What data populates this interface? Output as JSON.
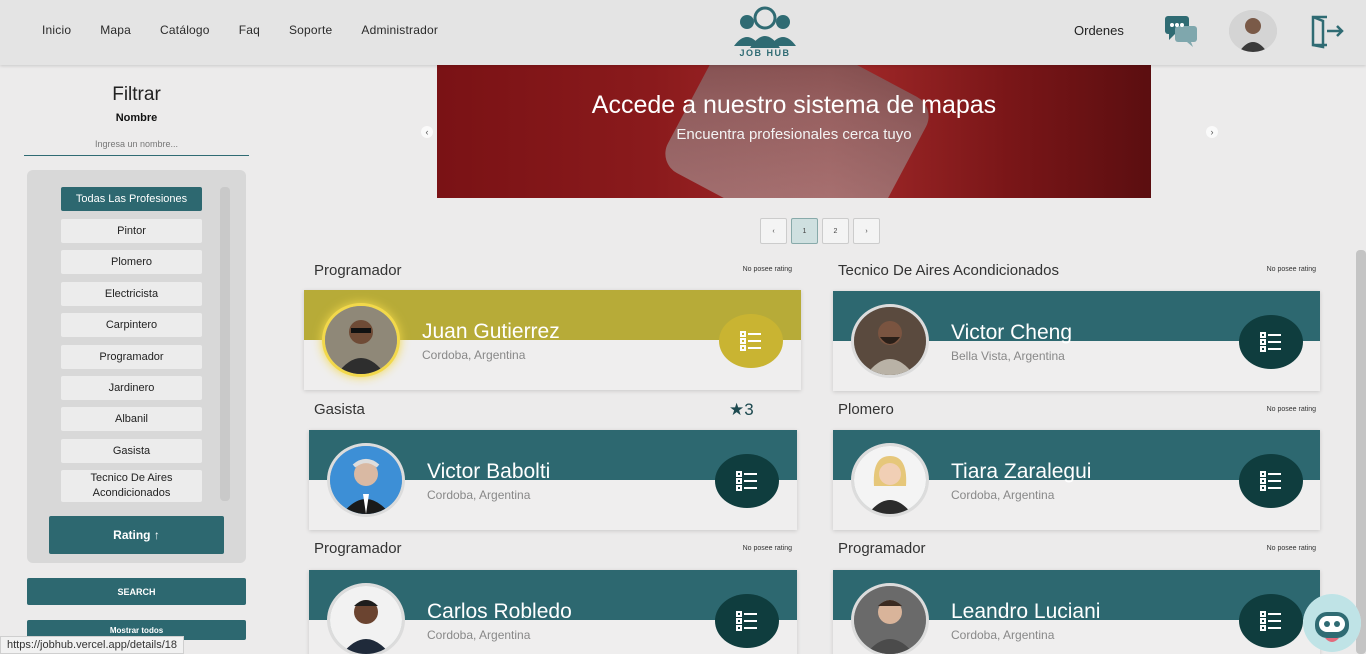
{
  "nav": {
    "items": [
      "Inicio",
      "Mapa",
      "Catálogo",
      "Faq",
      "Soporte",
      "Administrador"
    ],
    "logo_text": "JOB HUB",
    "ordenes": "Ordenes"
  },
  "sidebar": {
    "title": "Filtrar",
    "name_label": "Nombre",
    "name_placeholder": "Ingresa un nombre...",
    "professions": [
      "Todas Las Profesiones",
      "Pintor",
      "Plomero",
      "Electricista",
      "Carpintero",
      "Programador",
      "Jardinero",
      "Albanil",
      "Gasista",
      "Tecnico De Aires Acondicionados"
    ],
    "rating_button": "Rating ↑",
    "search_button": "SEARCH",
    "show_all_button": "Mostrar todos"
  },
  "banner": {
    "title": "Accede a nuestro sistema de mapas",
    "subtitle": "Encuentra profesionales cerca tuyo",
    "prev": "‹",
    "next": "›"
  },
  "pagination": [
    "‹",
    "1",
    "2",
    "›"
  ],
  "cards": [
    {
      "profession": "Programador",
      "rating": "No posee rating",
      "name": "Juan Gutierrez",
      "location": "Cordoba, Argentina"
    },
    {
      "profession": "Tecnico De Aires Acondicionados",
      "rating": "No posee rating",
      "name": "Victor Cheng",
      "location": "Bella Vista, Argentina"
    },
    {
      "profession": "Gasista",
      "rating": "3",
      "name": "Victor Babolti",
      "location": "Cordoba, Argentina"
    },
    {
      "profession": "Plomero",
      "rating": "No posee rating",
      "name": "Tiara Zaralegui",
      "location": "Cordoba, Argentina"
    },
    {
      "profession": "Programador",
      "rating": "No posee rating",
      "name": "Carlos Robledo",
      "location": "Cordoba, Argentina"
    },
    {
      "profession": "Programador",
      "rating": "No posee rating",
      "name": "Leandro Luciani",
      "location": "Cordoba, Argentina"
    }
  ],
  "status_url": "https://jobhub.vercel.app/details/18",
  "colors": {
    "primary": "#2d6870",
    "dark": "#0f3d3e",
    "gold": "#b7ab38",
    "background": "#ecebeb"
  }
}
